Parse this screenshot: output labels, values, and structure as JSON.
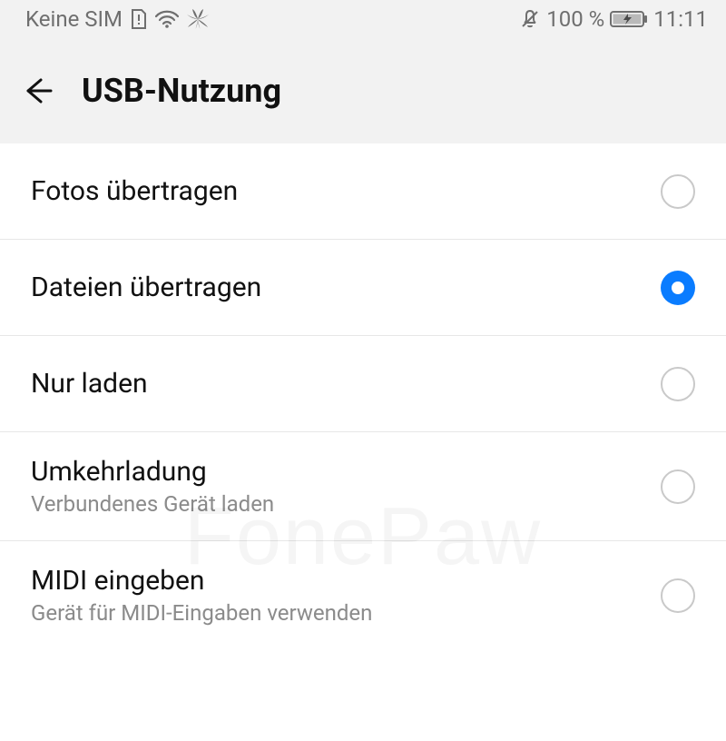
{
  "statusbar": {
    "carrier": "Keine SIM",
    "battery_text": "100 %",
    "time": "11:11"
  },
  "header": {
    "title": "USB-Nutzung"
  },
  "options": [
    {
      "label": "Fotos übertragen",
      "sub": "",
      "selected": false
    },
    {
      "label": "Dateien übertragen",
      "sub": "",
      "selected": true
    },
    {
      "label": "Nur laden",
      "sub": "",
      "selected": false
    },
    {
      "label": "Umkehrladung",
      "sub": "Verbundenes Gerät laden",
      "selected": false
    },
    {
      "label": "MIDI eingeben",
      "sub": "Gerät für MIDI-Eingaben verwenden",
      "selected": false
    }
  ],
  "watermark": "FonePaw"
}
